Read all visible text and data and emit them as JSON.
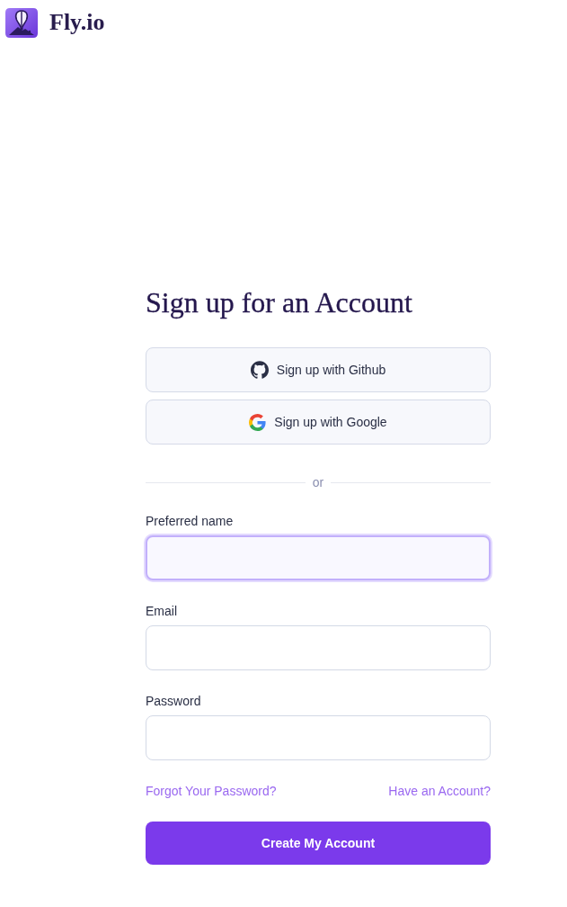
{
  "brand": {
    "name": "Fly.io"
  },
  "heading": "Sign up for an Account",
  "providers": [
    {
      "kind": "github",
      "label": "Sign up with Github"
    },
    {
      "kind": "google",
      "label": "Sign up with Google"
    }
  ],
  "divider": {
    "label": "or"
  },
  "fields": [
    {
      "label": "Preferred name",
      "focused": true
    },
    {
      "label": "Email",
      "focused": false
    },
    {
      "label": "Password",
      "focused": false
    }
  ],
  "links": [
    "Forgot Your Password?",
    "Have an Account?"
  ],
  "submit": {
    "label": "Create My Account"
  }
}
